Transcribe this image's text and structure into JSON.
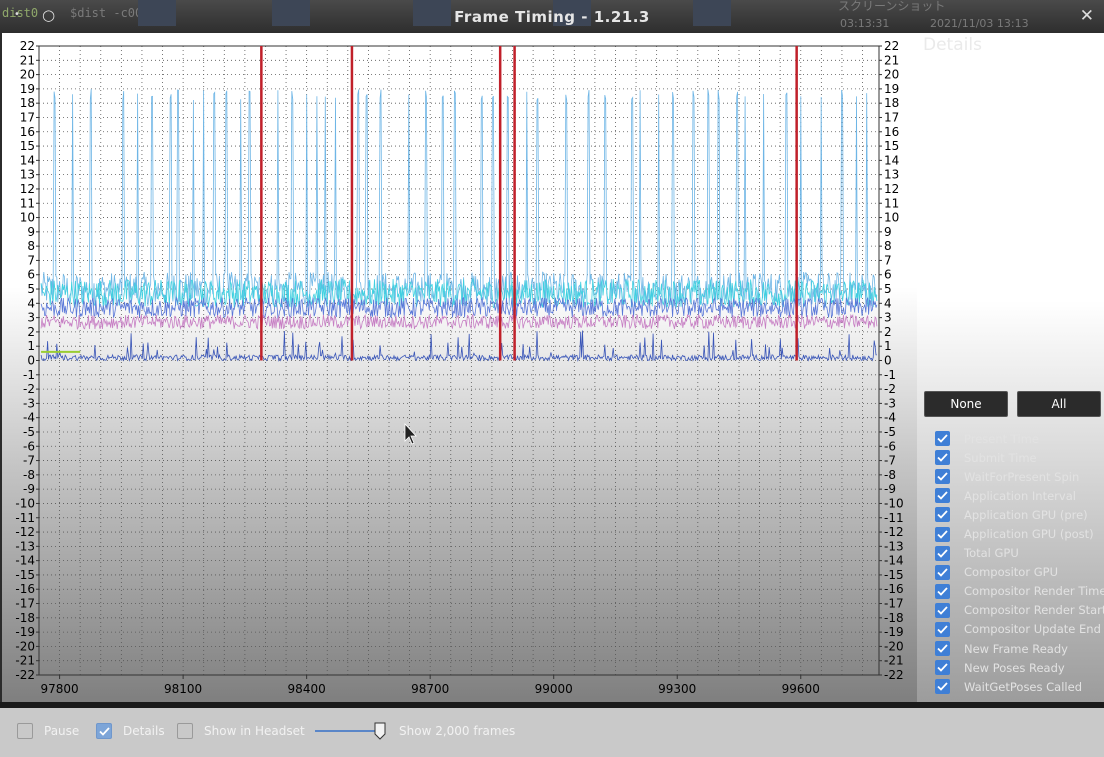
{
  "window": {
    "title": "Frame Timing - 1.21.3",
    "background_text": [
      "dist0",
      "$dist -c000",
      "スクリーンショット",
      "03:13:31",
      "2021/11/03 13:13"
    ],
    "close_label": "✕"
  },
  "chart_data": {
    "type": "line",
    "xlim": [
      97750,
      99790
    ],
    "ylim": [
      -22,
      22
    ],
    "x_ticks": [
      97800,
      98100,
      98400,
      98700,
      99000,
      99300,
      99600
    ],
    "y_ticks": [
      22,
      21,
      20,
      19,
      18,
      17,
      16,
      15,
      14,
      13,
      12,
      11,
      10,
      9,
      8,
      7,
      6,
      5,
      4,
      3,
      2,
      1,
      0,
      -1,
      -2,
      -3,
      -4,
      -5,
      -6,
      -7,
      -8,
      -9,
      -10,
      -11,
      -12,
      -13,
      -14,
      -15,
      -16,
      -17,
      -18,
      -19,
      -20,
      -21,
      -22
    ],
    "grid": true,
    "red_markers": [
      98290,
      98510,
      98870,
      98905,
      99590
    ],
    "series": [
      {
        "color": "#6fb6e6",
        "base": 5.0,
        "spread": 1.2,
        "spikes": [
          97788,
          97832,
          97875,
          97955,
          97990,
          98025,
          98070,
          98088,
          98125,
          98150,
          98175,
          98205,
          98240,
          98262,
          98330,
          98365,
          98400,
          98425,
          98445,
          98470,
          98525,
          98545,
          98580,
          98648,
          98690,
          98730,
          98760,
          98825,
          98852,
          98888,
          98935,
          98960,
          99030,
          99085,
          99125,
          99190,
          99210,
          99255,
          99290,
          99340,
          99375,
          99400,
          99445,
          99465,
          99510,
          99565,
          99600,
          99650,
          99700,
          99735,
          99760
        ],
        "spike_value": 19
      },
      {
        "color": "#3fd0e0",
        "base": 4.7,
        "spread": 1.0
      },
      {
        "color": "#5a78d8",
        "base": 3.7,
        "spread": 0.7
      },
      {
        "color": "#c77fc4",
        "base": 2.7,
        "spread": 0.5
      },
      {
        "color": "#3a56b8",
        "base": 0.2,
        "spread": 0.2,
        "small_spikes": true
      },
      {
        "color": "#9acd32",
        "flat": 0.6,
        "from": 97755,
        "to": 97850
      }
    ]
  },
  "panel": {
    "details_title": "Details",
    "none_button": "None",
    "all_button": "All",
    "series_labels": [
      "Present Time",
      "Submit Time",
      "WaitForPresent Spin",
      "Application Interval",
      "Application GPU (pre)",
      "Application GPU (post)",
      "Total GPU",
      "Compositor GPU",
      "Compositor Render Time",
      "Compositor Render Start",
      "Compositor Update End",
      "New Frame Ready",
      "New Poses Ready",
      "WaitGetPoses Called"
    ]
  },
  "footer": {
    "pause_label": "Pause",
    "details_label": "Details",
    "headset_label": "Show in Headset",
    "frames_label": "Show 2,000 frames",
    "details_checked": true,
    "pause_checked": false,
    "headset_checked": false
  },
  "colors": {
    "accent": "#3f7fd6",
    "marker": "#c0202a"
  }
}
